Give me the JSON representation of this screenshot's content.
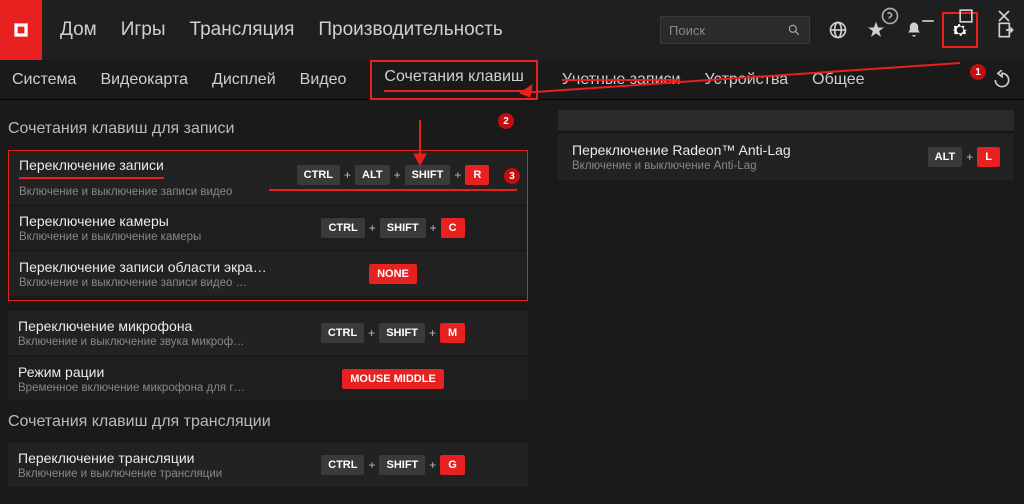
{
  "topbar": {
    "nav": [
      "Дом",
      "Игры",
      "Трансляция",
      "Производительность"
    ],
    "search_placeholder": "Поиск"
  },
  "subtabs": {
    "items": [
      "Система",
      "Видеокарта",
      "Дисплей",
      "Видео",
      "Сочетания клавиш",
      "Учетные записи",
      "Устройства",
      "Общее"
    ],
    "active_index": 4,
    "strike_index": 5
  },
  "sections": {
    "recording_title": "Сочетания клавиш для записи",
    "streaming_title": "Сочетания клавиш для трансляции"
  },
  "rows_recording": [
    {
      "title": "Переключение записи",
      "sub": "Включение и выключение записи видео",
      "keys": [
        "CTRL",
        "ALT",
        "SHIFT"
      ],
      "final": "R",
      "type": "keys"
    },
    {
      "title": "Переключение камеры",
      "sub": "Включение и выключение камеры",
      "keys": [
        "CTRL",
        "SHIFT"
      ],
      "final": "C",
      "type": "keys"
    },
    {
      "title": "Переключение записи области экра…",
      "sub": "Включение и выключение записи видео …",
      "keys": [],
      "final": "NONE",
      "type": "none"
    },
    {
      "title": "Переключение микрофона",
      "sub": "Включение и выключение звука микроф…",
      "keys": [
        "CTRL",
        "SHIFT"
      ],
      "final": "M",
      "type": "keys"
    },
    {
      "title": "Режим рации",
      "sub": "Временное включение микрофона для г…",
      "keys": [],
      "final": "MOUSE MIDDLE",
      "type": "none"
    }
  ],
  "rows_streaming": [
    {
      "title": "Переключение трансляции",
      "sub": "Включение и выключение трансляции",
      "keys": [
        "CTRL",
        "SHIFT"
      ],
      "final": "G",
      "type": "keys"
    }
  ],
  "right_panel": {
    "title": "Переключение Radeon™ Anti-Lag",
    "sub": "Включение и выключение Anti-Lag",
    "keys": [
      "ALT"
    ],
    "final": "L"
  },
  "markers": {
    "1": "1",
    "2": "2",
    "3": "3"
  }
}
